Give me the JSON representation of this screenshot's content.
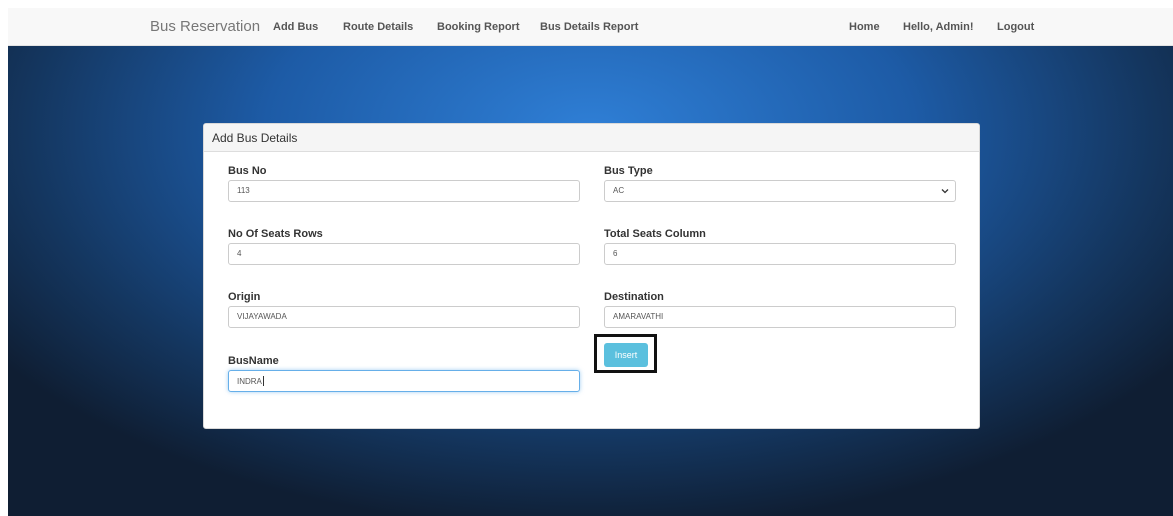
{
  "navbar": {
    "brand": "Bus Reservation",
    "left_links": [
      "Add Bus",
      "Route Details",
      "Booking Report",
      "Bus Details Report"
    ],
    "right_links": [
      "Home",
      "Hello, Admin!",
      "Logout"
    ]
  },
  "panel": {
    "title": "Add Bus Details"
  },
  "form": {
    "bus_no": {
      "label": "Bus No",
      "value": "113"
    },
    "bus_type": {
      "label": "Bus Type",
      "value": "AC"
    },
    "seat_rows": {
      "label": "No Of Seats Rows",
      "value": "4"
    },
    "seat_columns": {
      "label": "Total Seats Column",
      "value": "6"
    },
    "origin": {
      "label": "Origin",
      "value": "VIJAYAWADA"
    },
    "destination": {
      "label": "Destination",
      "value": "AMARAVATHI"
    },
    "bus_name": {
      "label": "BusName",
      "value": "INDRA"
    },
    "insert_label": "Insert"
  },
  "colors": {
    "navbar_bg": "#f8f8f8",
    "hero_blue": "#1d5ba6",
    "button_info": "#5bc0de",
    "focus_border": "#66afe9"
  },
  "icons": {
    "select_indicator": "chevron-down-icon"
  }
}
